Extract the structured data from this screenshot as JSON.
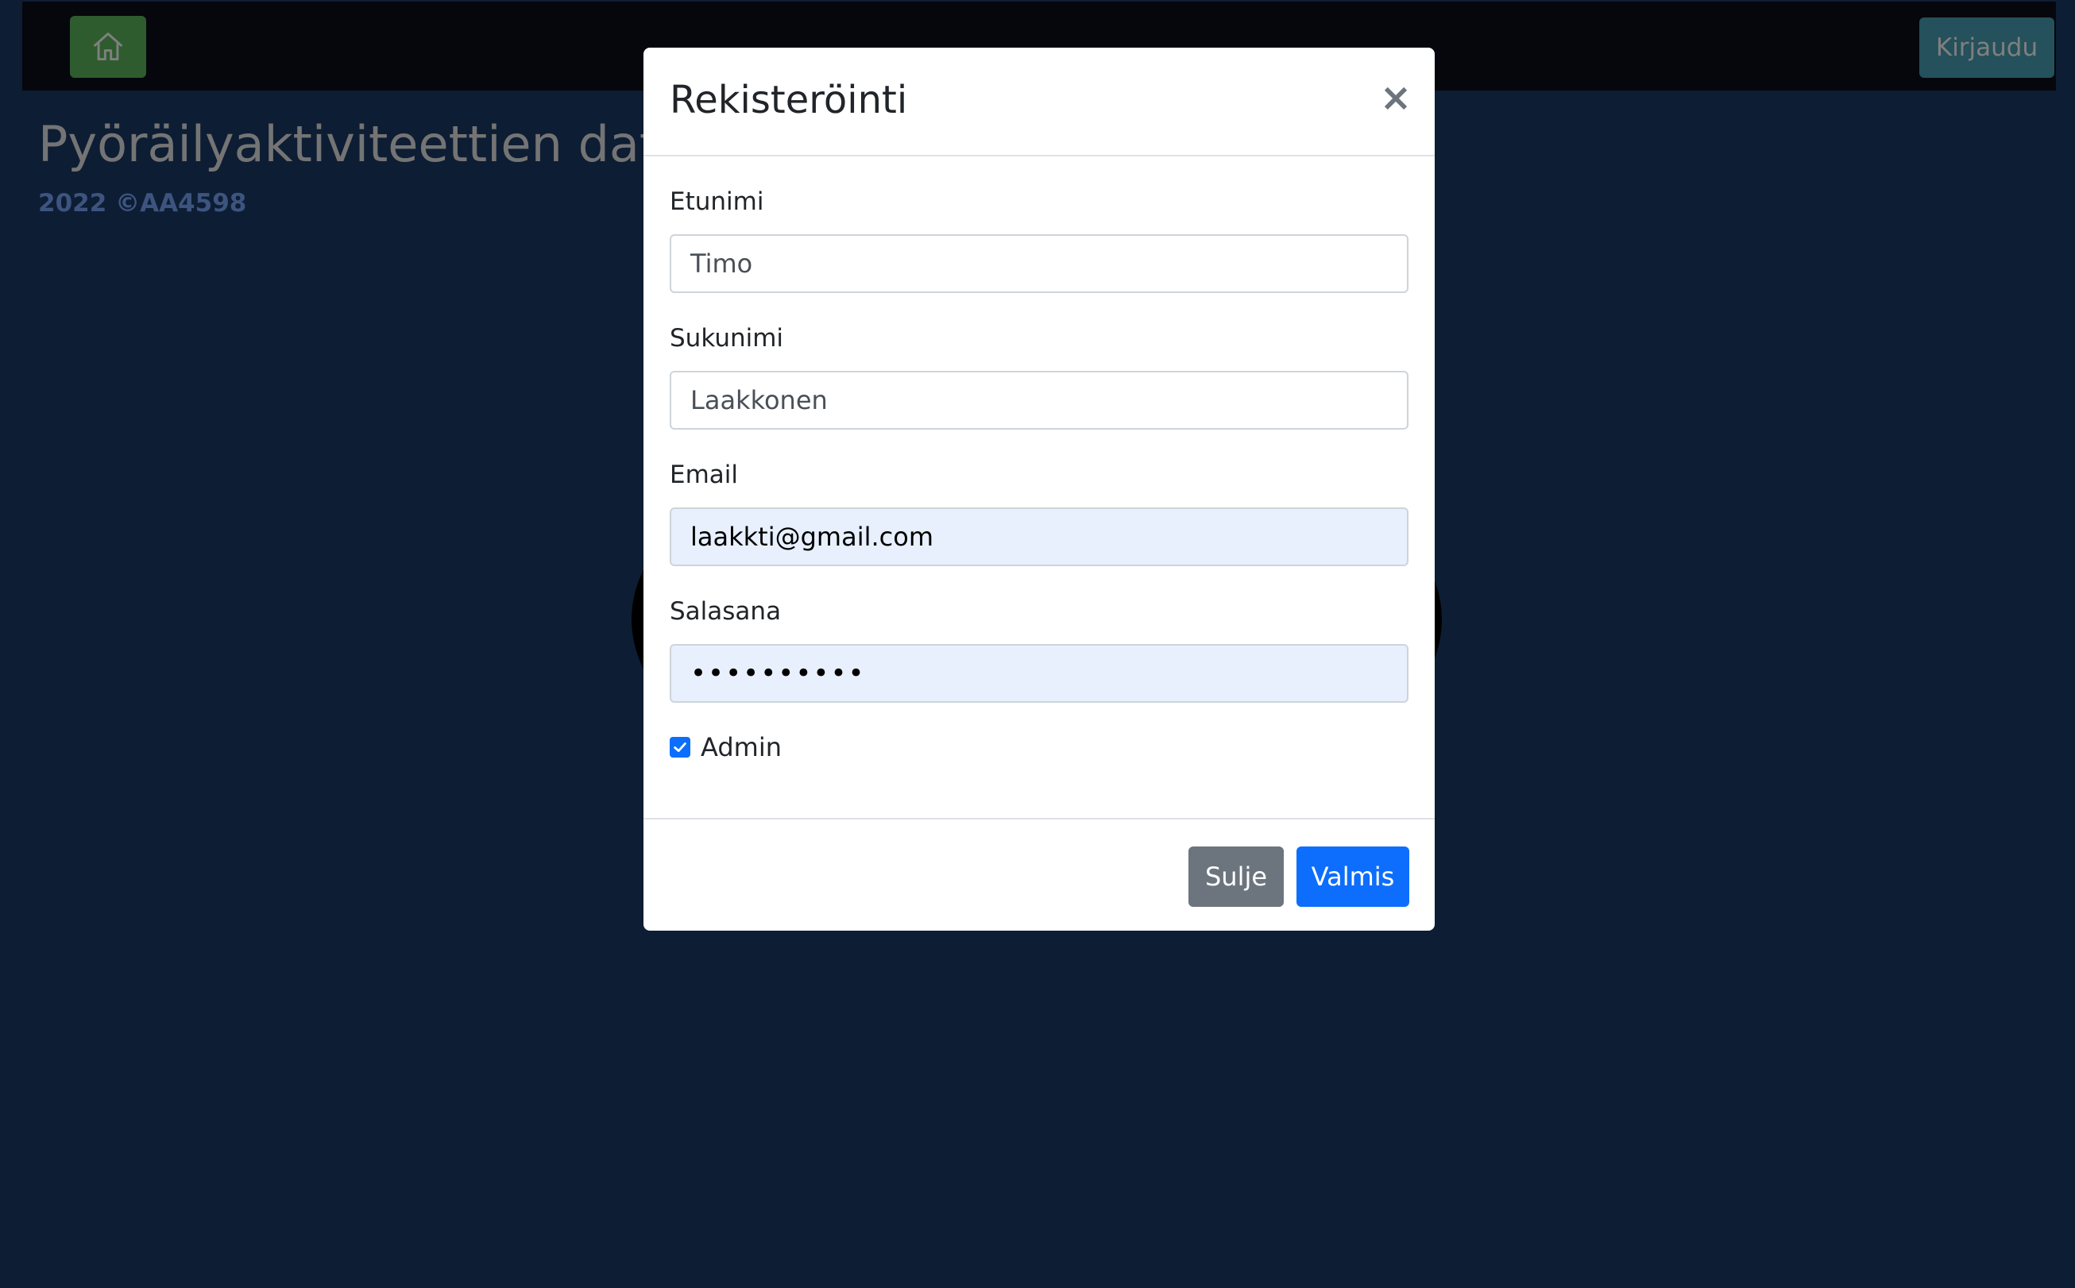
{
  "navbar": {
    "home_icon": "house-icon",
    "login_label": "Kirjaudu",
    "home_color": "#5cb85c",
    "login_color": "#48a3b6"
  },
  "page": {
    "title": "Pyöräilyaktiviteettien data-analyysi",
    "subtitle": "2022 ©AA4598"
  },
  "modal": {
    "title": "Rekisteröinti",
    "close_icon": "close-icon",
    "close_glyph": "×",
    "fields": {
      "first_name": {
        "label": "Etunimi",
        "value": "Timo"
      },
      "last_name": {
        "label": "Sukunimi",
        "value": "Laakkonen"
      },
      "email": {
        "label": "Email",
        "value": "laakkti@gmail.com"
      },
      "password": {
        "label": "Salasana",
        "value": "••••••••••"
      }
    },
    "admin": {
      "label": "Admin",
      "checked": true
    },
    "buttons": {
      "close_label": "Sulje",
      "done_label": "Valmis"
    },
    "colors": {
      "primary": "#0d6efd",
      "secondary": "#6c757d",
      "autofill": "#e8f0fe"
    }
  }
}
